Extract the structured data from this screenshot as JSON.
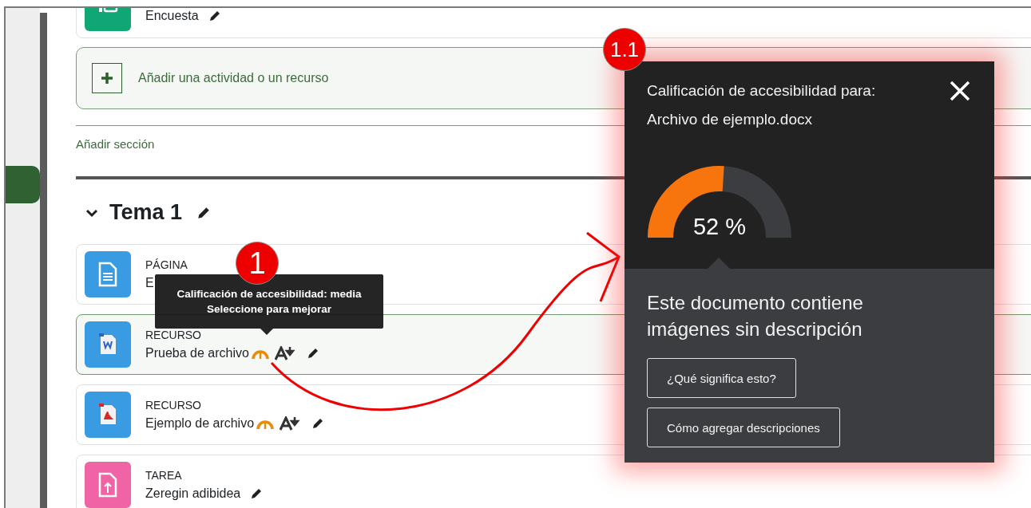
{
  "top_activities": [
    {
      "kind": "survey",
      "name": "Encuesta"
    }
  ],
  "add_activity": {
    "label": "Añadir una actividad o un recurso"
  },
  "add_section": {
    "label": "Añadir sección"
  },
  "section": {
    "title": "Tema 1",
    "expanded": true,
    "activities": [
      {
        "kind": "page",
        "type": "PÁGINA",
        "name": "E",
        "highlighted": false,
        "accessibility": false
      },
      {
        "kind": "word",
        "type": "RECURSO",
        "name": "Prueba de archivo",
        "highlighted": true,
        "accessibility": true
      },
      {
        "kind": "pdf",
        "type": "RECURSO",
        "name": "Ejemplo de archivo",
        "highlighted": false,
        "accessibility": true
      },
      {
        "kind": "assign",
        "type": "TAREA",
        "name": "Zeregin adibidea",
        "highlighted": false,
        "accessibility": false
      }
    ]
  },
  "tooltip": {
    "lines": [
      "Calificación de accesibilidad: media",
      "Seleccione para mejorar"
    ]
  },
  "callouts": [
    {
      "label": "1"
    },
    {
      "label": "1.1"
    }
  ],
  "popup": {
    "title": "Calificación de accesibilidad para:",
    "file": "Archivo de ejemplo.docx",
    "gauge": {
      "level": 0.52,
      "reading": "52 %"
    },
    "message": "Este documento contiene imágenes sin descripción",
    "buttons": [
      "¿Qué significa esto?",
      "Cómo agregar descripciones"
    ]
  }
}
